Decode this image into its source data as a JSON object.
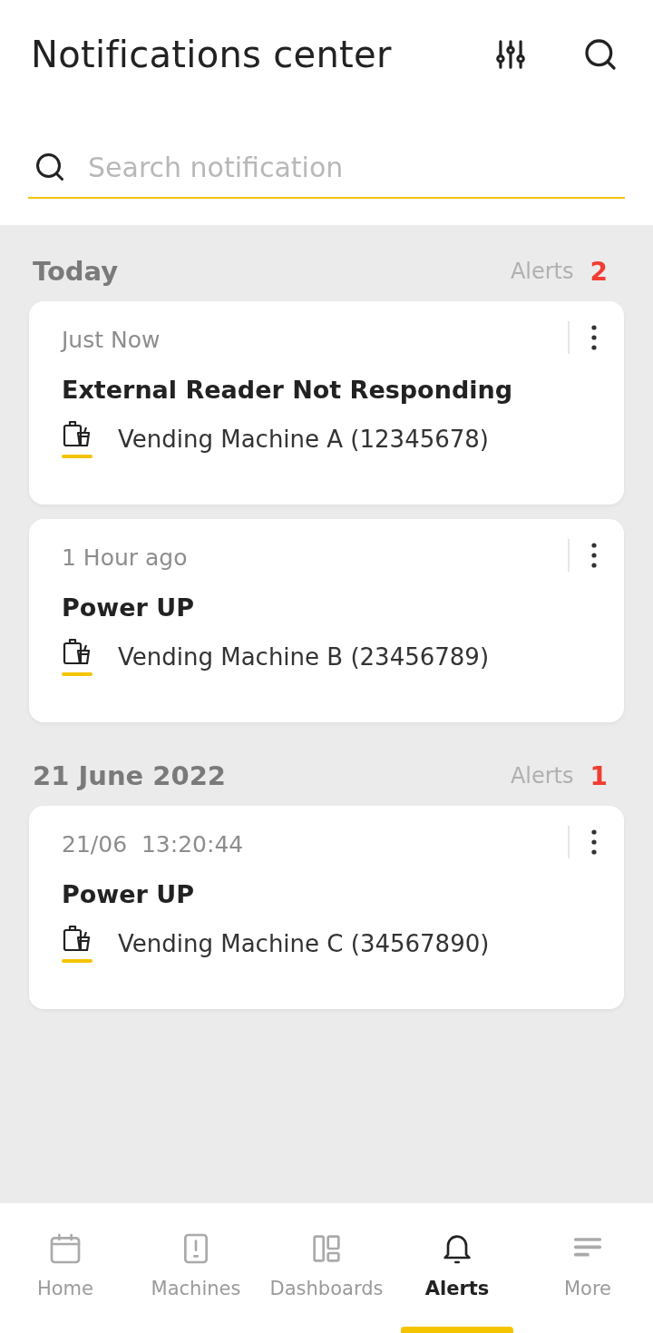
{
  "header": {
    "title": "Notifications center"
  },
  "search": {
    "placeholder": "Search notification"
  },
  "groups": [
    {
      "title": "Today",
      "alerts_label": "Alerts",
      "count": "2",
      "notifications": [
        {
          "time": "Just Now",
          "title": "External Reader Not Responding",
          "machine": "Vending Machine A (12345678)"
        },
        {
          "time": "1 Hour ago",
          "title": "Power UP",
          "machine": "Vending Machine B (23456789)"
        }
      ]
    },
    {
      "title": "21 June 2022",
      "alerts_label": "Alerts",
      "count": "1",
      "notifications": [
        {
          "time": "21/06  13:20:44",
          "title": "Power UP",
          "machine": "Vending Machine C (34567890)"
        }
      ]
    }
  ],
  "nav": [
    {
      "kind": "home",
      "label": "Home",
      "selected": false
    },
    {
      "kind": "machines",
      "label": "Machines",
      "selected": false
    },
    {
      "kind": "dashboards",
      "label": "Dashboards",
      "selected": false
    },
    {
      "kind": "alerts",
      "label": "Alerts",
      "selected": true
    },
    {
      "kind": "more",
      "label": "More",
      "selected": false
    }
  ]
}
